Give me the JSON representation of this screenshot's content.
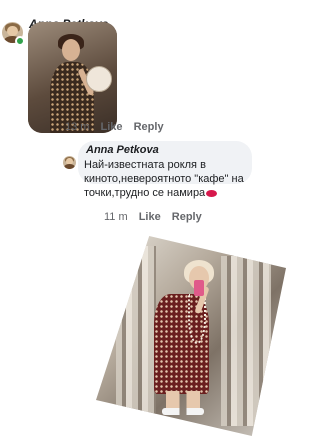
{
  "comment": {
    "author": "Anna Petkova",
    "time": "13 m",
    "like_label": "Like",
    "reply_label": "Reply"
  },
  "reply": {
    "author": "Anna Petkova",
    "text": "Най-известната рокля в киното,невероятното \"кафе\" на точки,трудно се намира",
    "emoji": "kiss-lips-icon",
    "time": "11 m",
    "like_label": "Like",
    "reply_label": "Reply"
  },
  "colors": {
    "meta_text": "#65676b",
    "bubble_bg": "#f0f2f5",
    "online": "#31a24c"
  }
}
